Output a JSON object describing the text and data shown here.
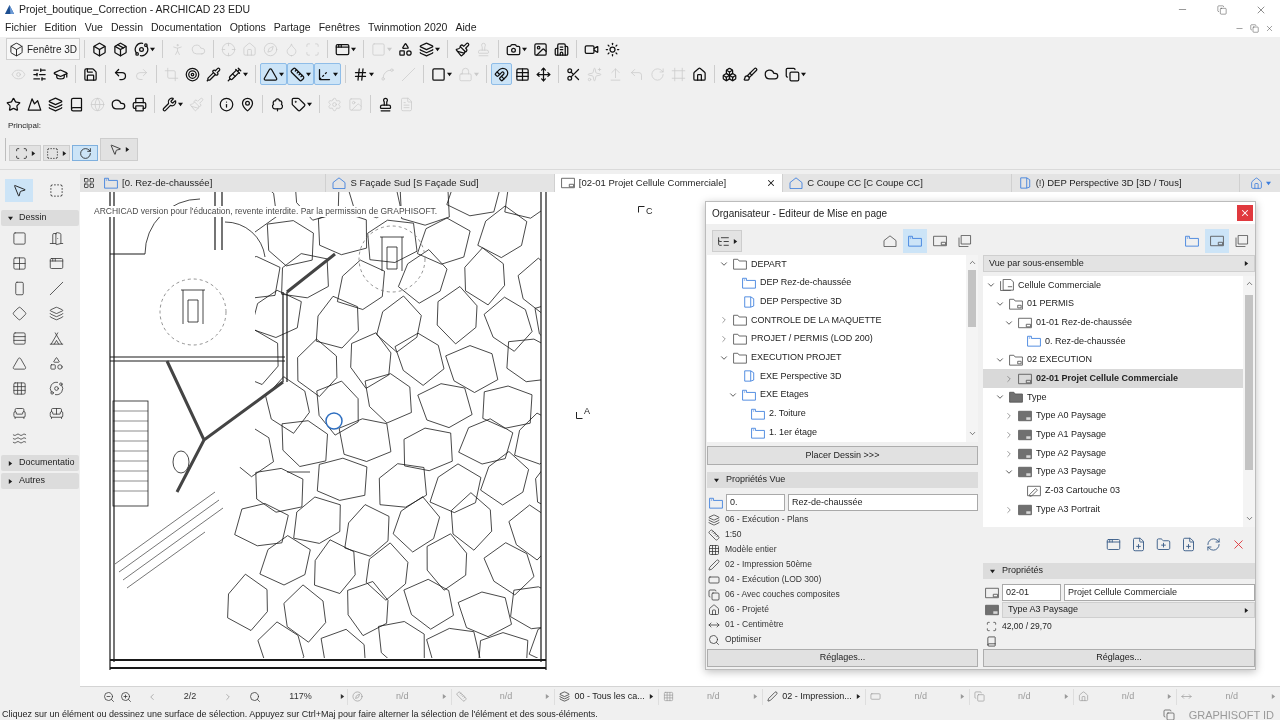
{
  "window": {
    "title": "Projet_boutique_Correction - ARCHICAD 23 EDU"
  },
  "menu": [
    "Fichier",
    "Edition",
    "Vue",
    "Dessin",
    "Documentation",
    "Options",
    "Partage",
    "Fenêtres",
    "Twinmotion 2020",
    "Aide"
  ],
  "toolbars": [
    {
      "button": "Fenêtre 3D",
      "items": [
        {
          "on": false,
          "disabled": false
        },
        {
          "on": false,
          "disabled": false
        },
        {
          "on": false,
          "disabled": false
        },
        {
          "on": false,
          "disabled": true
        },
        {
          "on": false,
          "disabled": true
        },
        {
          "on": false,
          "disabled": true
        },
        {
          "on": false,
          "disabled": true
        },
        {
          "on": false,
          "disabled": true
        },
        {
          "on": false,
          "disabled": true
        },
        {
          "on": false,
          "disabled": true
        },
        {
          "on": false,
          "disabled": false
        },
        {
          "on": false,
          "disabled": true
        },
        {
          "on": false,
          "disabled": false
        },
        {
          "on": false,
          "disabled": false
        },
        {
          "on": false,
          "disabled": false
        },
        {
          "on": false,
          "disabled": true
        },
        {
          "on": false,
          "disabled": false
        },
        {
          "on": false,
          "disabled": false
        },
        {
          "on": false,
          "disabled": false
        },
        {
          "on": false,
          "disabled": false
        },
        {
          "on": false,
          "disabled": false
        }
      ]
    },
    {
      "items": [
        {
          "on": false,
          "disabled": true
        },
        {
          "on": false,
          "disabled": false
        },
        {
          "on": false,
          "disabled": false
        },
        {
          "on": false,
          "disabled": false
        },
        {
          "on": false,
          "disabled": false
        },
        {
          "on": false,
          "disabled": true
        },
        {
          "on": false,
          "disabled": true
        },
        {
          "on": false,
          "disabled": false
        },
        {
          "on": false,
          "disabled": false
        },
        {
          "on": false,
          "disabled": false
        },
        {
          "on": true,
          "disabled": false
        },
        {
          "on": true,
          "disabled": false
        },
        {
          "on": true,
          "disabled": false
        },
        {
          "on": false,
          "disabled": false
        },
        {
          "on": false,
          "disabled": true
        },
        {
          "on": false,
          "disabled": true
        },
        {
          "on": false,
          "disabled": false
        },
        {
          "on": false,
          "disabled": true
        },
        {
          "on": true,
          "disabled": false
        },
        {
          "on": false,
          "disabled": false
        },
        {
          "on": false,
          "disabled": false
        },
        {
          "on": false,
          "disabled": false
        },
        {
          "on": false,
          "disabled": true
        },
        {
          "on": false,
          "disabled": true
        },
        {
          "on": false,
          "disabled": true
        },
        {
          "on": false,
          "disabled": true
        },
        {
          "on": false,
          "disabled": true
        },
        {
          "on": false,
          "disabled": false
        },
        {
          "on": false,
          "disabled": false
        },
        {
          "on": false,
          "disabled": false
        },
        {
          "on": false,
          "disabled": false
        },
        {
          "on": false,
          "disabled": false
        }
      ]
    },
    {
      "items": [
        {
          "on": false,
          "disabled": false
        },
        {
          "on": false,
          "disabled": false
        },
        {
          "on": false,
          "disabled": false
        },
        {
          "on": false,
          "disabled": false
        },
        {
          "on": false,
          "disabled": true
        },
        {
          "on": false,
          "disabled": false
        },
        {
          "on": false,
          "disabled": false
        },
        {
          "on": false,
          "disabled": false
        },
        {
          "on": false,
          "disabled": true
        },
        {
          "on": false,
          "disabled": false
        },
        {
          "on": false,
          "disabled": false
        },
        {
          "on": false,
          "disabled": false
        },
        {
          "on": false,
          "disabled": false
        },
        {
          "on": false,
          "disabled": true
        },
        {
          "on": false,
          "disabled": true
        },
        {
          "on": false,
          "disabled": false
        },
        {
          "on": false,
          "disabled": true
        }
      ]
    }
  ],
  "info_box": {
    "label": "Principal:",
    "tools": [
      {
        "selected": false
      },
      {
        "selected": false
      },
      {
        "selected": true
      },
      {
        "selected": false
      }
    ]
  },
  "toolbox": {
    "tools": [
      {
        "selected": true
      },
      {
        "selected": false
      }
    ],
    "groups": [
      {
        "label": "Dessin",
        "expanded": true
      },
      {
        "label": "Documentatio",
        "expanded": false
      },
      {
        "label": "Autres",
        "expanded": false
      }
    ]
  },
  "tabs": [
    {
      "kind": "plan",
      "label": "[0. Rez-de-chaussée]",
      "selected": false
    },
    {
      "kind": "elevation",
      "label": "S Façade Sud [S Façade Sud]",
      "selected": false
    },
    {
      "kind": "layout",
      "label": "[02-01 Projet Cellule Commerciale]",
      "selected": true
    },
    {
      "kind": "section",
      "label": "C Coupe CC [C Coupe CC]",
      "selected": false
    },
    {
      "kind": "perspective",
      "label": "(!) DEP Perspective 3D [3D / Tous]",
      "selected": false
    }
  ],
  "canvas": {
    "notice": "ARCHICAD version pour l'éducation, revente interdite. Par la permission de GRAPHISOFT.",
    "markers": [
      "C",
      "A"
    ]
  },
  "organizer": {
    "title": "Organisateur - Editeur de Mise en page",
    "view_map": {
      "mode_buttons": [
        {
          "selected": false
        },
        {
          "selected": true
        },
        {
          "selected": false
        },
        {
          "selected": false
        }
      ],
      "tree": [
        {
          "kind": "folder",
          "label": "DEPART",
          "expanded": true,
          "children": [
            {
              "kind": "plan",
              "label": "DEP Rez-de-chaussée"
            },
            {
              "kind": "perspective",
              "label": "DEP Perspective 3D"
            }
          ]
        },
        {
          "kind": "folder",
          "label": "CONTROLE DE LA MAQUETTE",
          "expanded": false
        },
        {
          "kind": "folder",
          "label": "PROJET / PERMIS (LOD 200)",
          "expanded": false
        },
        {
          "kind": "folder",
          "label": "EXECUTION PROJET",
          "expanded": true,
          "children": [
            {
              "kind": "perspective",
              "label": "EXE Perspective 3D"
            },
            {
              "kind": "plan",
              "label": "EXE Etages",
              "expanded": true,
              "children": [
                {
                  "kind": "plan",
                  "label": "2. Toiture"
                },
                {
                  "kind": "plan",
                  "label": "1. 1er étage"
                }
              ]
            }
          ]
        }
      ],
      "place_button": "Placer Dessin >>>",
      "properties": {
        "title": "Propriétés Vue",
        "expanded": true,
        "id": "0.",
        "name": "Rez-de-chaussée",
        "rows": [
          {
            "kind": "layers",
            "text": "06 - Exécution - Plans"
          },
          {
            "kind": "scale",
            "text": "1:50"
          },
          {
            "kind": "structure",
            "text": "Modèle entier"
          },
          {
            "kind": "pens",
            "text": "02 - Impression 50ème"
          },
          {
            "kind": "mvo",
            "text": "04 - Exécution (LOD 300)"
          },
          {
            "kind": "override",
            "text": "06 - Avec couches composites"
          },
          {
            "kind": "renovation",
            "text": "06 - Projeté"
          },
          {
            "kind": "dimension",
            "text": "01 - Centimètre"
          },
          {
            "kind": "zoom",
            "text": "Optimiser"
          }
        ]
      },
      "settings_button": "Réglages..."
    },
    "layout_book": {
      "mode_buttons": [
        {
          "selected": false
        },
        {
          "selected": true
        },
        {
          "selected": false
        }
      ],
      "view_menu": "Vue par sous-ensemble",
      "tree": [
        {
          "kind": "book",
          "label": "Cellule Commerciale",
          "expanded": true,
          "selected": false,
          "children": [
            {
              "kind": "subset",
              "label": "01 PERMIS",
              "expanded": true,
              "selected": false,
              "children": [
                {
                  "kind": "layout",
                  "label": "01-01 Rez-de-chaussée",
                  "expanded": true,
                  "selected": false,
                  "children": [
                    {
                      "kind": "plan",
                      "label": "0. Rez-de-chaussée",
                      "selected": false
                    }
                  ]
                }
              ]
            },
            {
              "kind": "subset",
              "label": "02 EXECUTION",
              "expanded": true,
              "selected": false,
              "children": [
                {
                  "kind": "layout",
                  "label": "02-01 Projet Cellule Commerciale",
                  "expanded": false,
                  "selected": true
                }
              ]
            },
            {
              "kind": "masters",
              "label": "Type",
              "expanded": true,
              "selected": false,
              "children": [
                {
                  "kind": "master",
                  "label": "Type A0 Paysage",
                  "expanded": false,
                  "selected": false
                },
                {
                  "kind": "master",
                  "label": "Type A1 Paysage",
                  "expanded": false,
                  "selected": false
                },
                {
                  "kind": "master",
                  "label": "Type A2 Paysage",
                  "expanded": false,
                  "selected": false
                },
                {
                  "kind": "master",
                  "label": "Type A3 Paysage",
                  "expanded": true,
                  "selected": false,
                  "children": [
                    {
                      "kind": "drawing",
                      "label": "Z-03 Cartouche 03",
                      "selected": false
                    }
                  ]
                },
                {
                  "kind": "master",
                  "label": "Type A3 Portrait",
                  "expanded": false,
                  "selected": false
                }
              ]
            }
          ]
        }
      ],
      "properties": {
        "title": "Propriétés",
        "expanded": true,
        "id": "02-01",
        "name": "Projet Cellule Commerciale",
        "master": "Type A3 Paysage",
        "size": "42,00 / 29,70"
      },
      "settings_button": "Réglages..."
    }
  },
  "navigator_bar": {
    "page": "2/2",
    "zoom": "117%",
    "fields": [
      {
        "kind": "orientation",
        "text": "n/d",
        "disabled": true
      },
      {
        "kind": "scale",
        "text": "n/d",
        "disabled": true
      },
      {
        "kind": "layers",
        "text": "00 - Tous les ca...",
        "disabled": false
      },
      {
        "kind": "structure",
        "text": "n/d",
        "disabled": true
      },
      {
        "kind": "pens",
        "text": "02 - Impression...",
        "disabled": false
      },
      {
        "kind": "mvo",
        "text": "n/d",
        "disabled": true
      },
      {
        "kind": "override",
        "text": "n/d",
        "disabled": true
      },
      {
        "kind": "renovation",
        "text": "n/d",
        "disabled": true
      },
      {
        "kind": "dimension",
        "text": "n/d",
        "disabled": true
      }
    ]
  },
  "status_bar": {
    "message": "Cliquez sur un élément ou dessinez une surface de sélection. Appuyez sur Ctrl+Maj pour faire alterner la sélection de l'élément et des sous-éléments.",
    "account": "GRAPHISOFT ID"
  }
}
